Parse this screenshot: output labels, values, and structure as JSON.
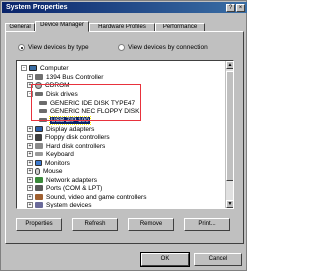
{
  "window": {
    "title": "System Properties",
    "close_glyph": "×",
    "help_glyph": "?"
  },
  "tabs": [
    {
      "label": "General"
    },
    {
      "label": "Device Manager"
    },
    {
      "label": "Hardware Profiles"
    },
    {
      "label": "Performance"
    }
  ],
  "view_options": {
    "by_type": "View devices by type",
    "by_connection": "View devices by connection",
    "selected": "by_type"
  },
  "tree": {
    "root": "Computer",
    "items": [
      {
        "label": "1394 Bus Controller",
        "expander": "+"
      },
      {
        "label": "CDROM",
        "expander": "+"
      },
      {
        "label": "Disk drives",
        "expander": "-"
      },
      {
        "label": "GENERIC IDE DISK TYPE47",
        "child": true
      },
      {
        "label": "GENERIC NEC FLOPPY DISK",
        "child": true
      },
      {
        "label": "USB ZIP 100",
        "child": true,
        "selected": true
      },
      {
        "label": "Display adapters",
        "expander": "+"
      },
      {
        "label": "Floppy disk controllers",
        "expander": "+"
      },
      {
        "label": "Hard disk controllers",
        "expander": "+"
      },
      {
        "label": "Keyboard",
        "expander": "+"
      },
      {
        "label": "Monitors",
        "expander": "+"
      },
      {
        "label": "Mouse",
        "expander": "+"
      },
      {
        "label": "Network adapters",
        "expander": "+"
      },
      {
        "label": "Ports (COM & LPT)",
        "expander": "+"
      },
      {
        "label": "Sound, video and game controllers",
        "expander": "+"
      },
      {
        "label": "System devices",
        "expander": "+"
      }
    ]
  },
  "panel_buttons": {
    "properties": "Properties",
    "refresh": "Refresh",
    "remove": "Remove",
    "print": "Print..."
  },
  "window_buttons": {
    "ok": "OK",
    "cancel": "Cancel"
  },
  "colors": {
    "selection": "#0a246a",
    "highlight_annotation": "#e8323c",
    "title_bar": "#0a246a"
  }
}
